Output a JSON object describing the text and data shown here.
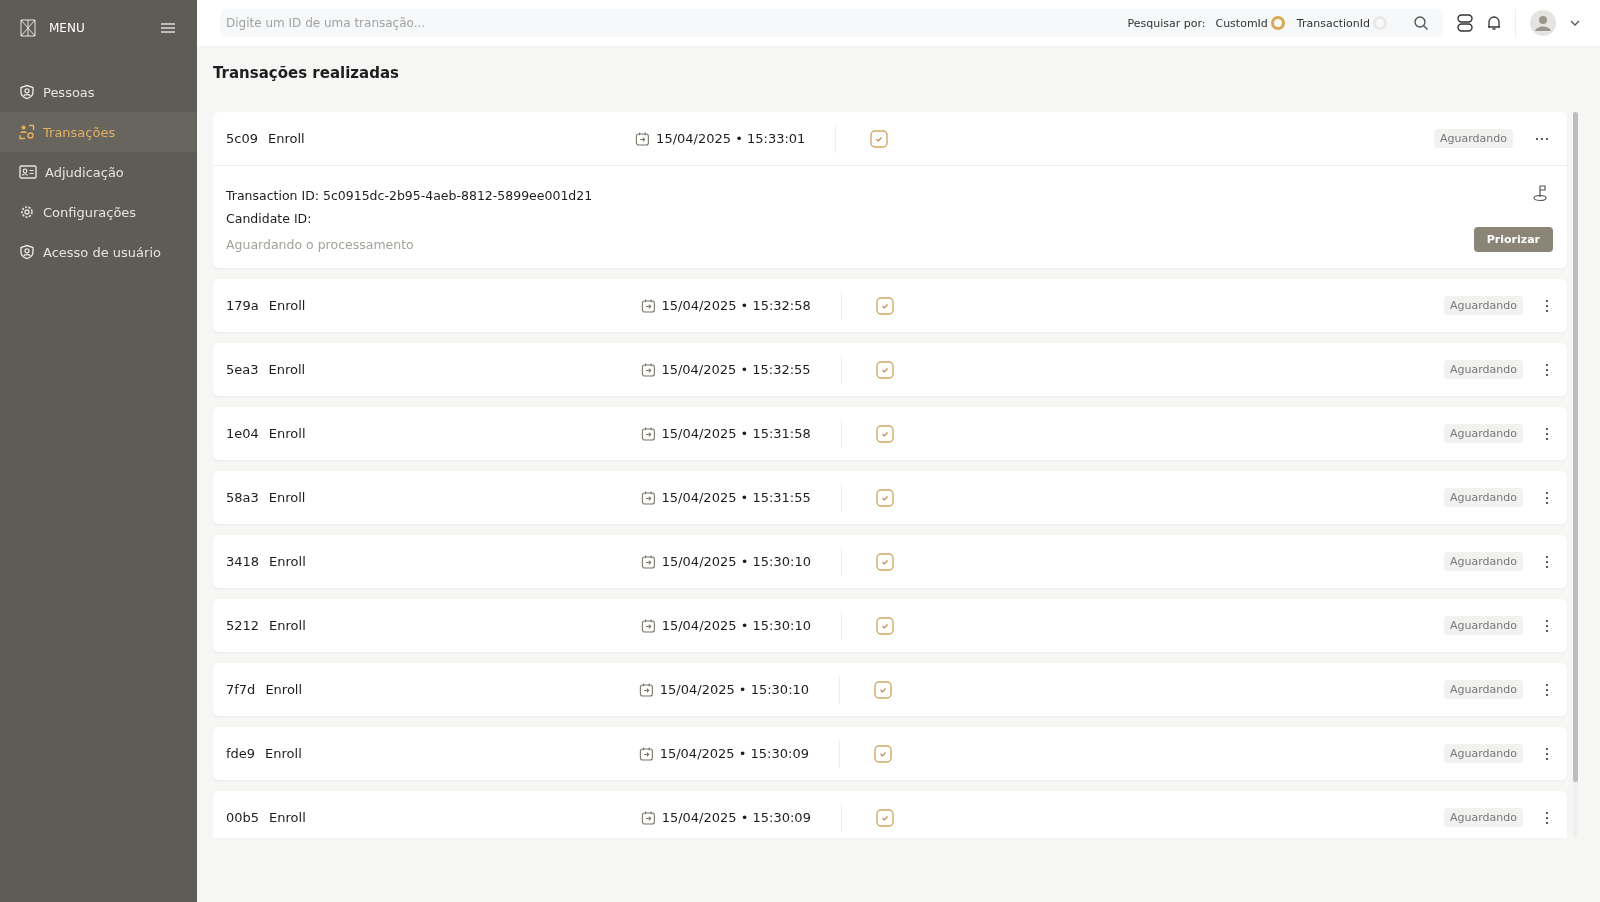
{
  "sidebar": {
    "title": "MENU",
    "items": [
      {
        "label": "Pessoas",
        "kind": "person",
        "selected": false
      },
      {
        "label": "Transações",
        "kind": "transactions",
        "selected": true
      },
      {
        "label": "Adjudicação",
        "kind": "card",
        "selected": false
      },
      {
        "label": "Configurações",
        "kind": "gear",
        "selected": false
      },
      {
        "label": "Acesso de usuário",
        "kind": "person",
        "selected": false
      }
    ]
  },
  "search": {
    "placeholder": "Digite um ID de uma transação...",
    "search_by_label": "Pesquisar por:",
    "options": [
      {
        "label": "CustomId",
        "selected": true
      },
      {
        "label": "TransactionId",
        "selected": false
      }
    ]
  },
  "page_title": "Transações realizadas",
  "transactions": [
    {
      "short_id": "5c09",
      "type": "Enroll",
      "date": "15/04/2025 • 15:33:01",
      "status": "Aguardando",
      "expanded": true,
      "details": {
        "transaction_id": "Transaction ID: 5c0915dc-2b95-4aeb-8812-5899ee001d21",
        "candidate_id": "Candidate ID:",
        "message": "Aguardando o processamento",
        "button": "Priorizar"
      }
    },
    {
      "short_id": "179a",
      "type": "Enroll",
      "date": "15/04/2025 • 15:32:58",
      "status": "Aguardando",
      "expanded": false
    },
    {
      "short_id": "5ea3",
      "type": "Enroll",
      "date": "15/04/2025 • 15:32:55",
      "status": "Aguardando",
      "expanded": false
    },
    {
      "short_id": "1e04",
      "type": "Enroll",
      "date": "15/04/2025 • 15:31:58",
      "status": "Aguardando",
      "expanded": false
    },
    {
      "short_id": "58a3",
      "type": "Enroll",
      "date": "15/04/2025 • 15:31:55",
      "status": "Aguardando",
      "expanded": false
    },
    {
      "short_id": "3418",
      "type": "Enroll",
      "date": "15/04/2025 • 15:30:10",
      "status": "Aguardando",
      "expanded": false
    },
    {
      "short_id": "5212",
      "type": "Enroll",
      "date": "15/04/2025 • 15:30:10",
      "status": "Aguardando",
      "expanded": false
    },
    {
      "short_id": "7f7d",
      "type": "Enroll",
      "date": "15/04/2025 • 15:30:10",
      "status": "Aguardando",
      "expanded": false
    },
    {
      "short_id": "fde9",
      "type": "Enroll",
      "date": "15/04/2025 • 15:30:09",
      "status": "Aguardando",
      "expanded": false
    },
    {
      "short_id": "00b5",
      "type": "Enroll",
      "date": "15/04/2025 • 15:30:09",
      "status": "Aguardando",
      "expanded": false
    }
  ]
}
